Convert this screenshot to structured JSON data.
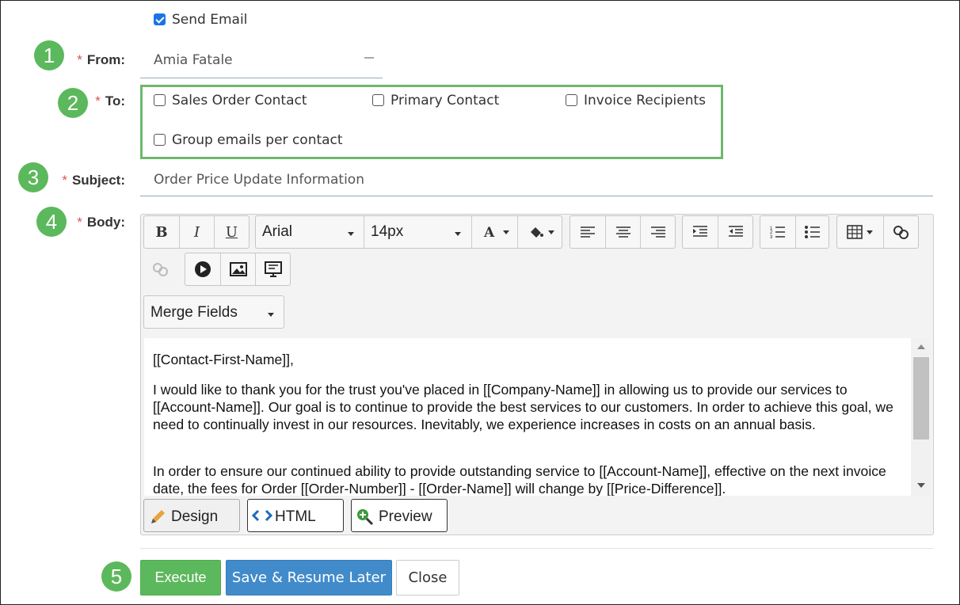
{
  "send_email": {
    "label": "Send Email",
    "checked": true
  },
  "callouts": [
    "1",
    "2",
    "3",
    "4",
    "5"
  ],
  "from": {
    "label": "From:",
    "value": "Amia Fatale"
  },
  "to": {
    "label": "To:",
    "options": [
      {
        "label": "Sales Order Contact",
        "checked": false
      },
      {
        "label": "Primary Contact",
        "checked": false
      },
      {
        "label": "Invoice Recipients",
        "checked": false
      },
      {
        "label": "Group emails per contact",
        "checked": false
      }
    ]
  },
  "subject": {
    "label": "Subject:",
    "value": "Order Price Update Information"
  },
  "body": {
    "label": "Body:",
    "toolbar": {
      "bold": "B",
      "italic": "I",
      "underline": "U",
      "font": "Arial",
      "size": "14px",
      "merge_fields": "Merge Fields"
    },
    "content": [
      "[[Contact-First-Name]],",
      "I would like to thank you for the trust you've placed in [[Company-Name]] in allowing us to provide our services to [[Account-Name]]. Our goal is to continue to provide the best services to our customers. In order to achieve this goal, we need to continually invest in our resources. Inevitably, we experience increases in costs on an annual basis.",
      "In order to ensure our continued ability to provide outstanding service to [[Account-Name]], effective on the next invoice date, the fees for Order [[Order-Number]] - [[Order-Name]] will change by [[Price-Difference]]."
    ],
    "tabs": {
      "design": "Design",
      "html": "HTML",
      "preview": "Preview"
    }
  },
  "actions": {
    "execute": "Execute",
    "save": "Save & Resume Later",
    "close": "Close"
  },
  "colors": {
    "accent_green": "#5cb85c",
    "primary_blue": "#428bca",
    "required_red": "#d9534f",
    "checkbox_blue": "#1a73e8"
  }
}
